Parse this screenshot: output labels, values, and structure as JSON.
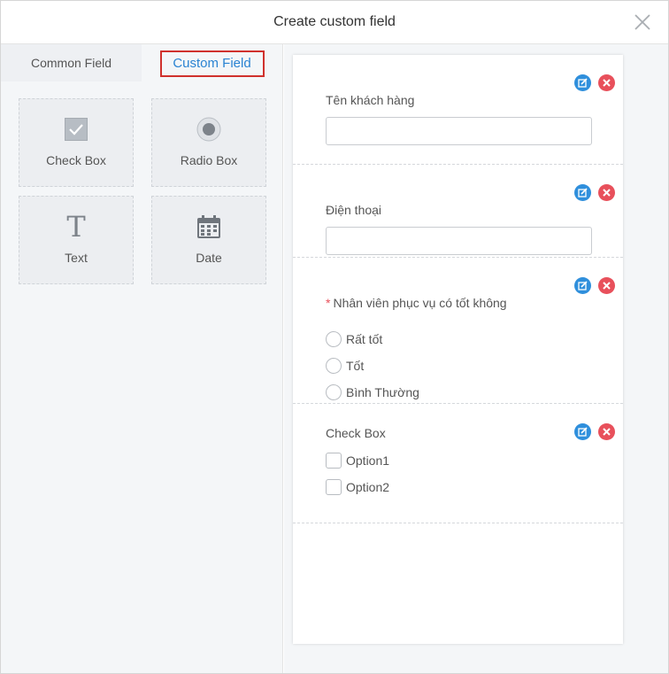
{
  "dialog": {
    "title": "Create custom field"
  },
  "tabs": {
    "common": "Common Field",
    "custom": "Custom Field"
  },
  "tiles": [
    {
      "label": "Check Box",
      "icon": "checkbox-icon"
    },
    {
      "label": "Radio Box",
      "icon": "radio-icon"
    },
    {
      "label": "Text",
      "icon": "text-icon"
    },
    {
      "label": "Date",
      "icon": "calendar-icon"
    }
  ],
  "fields": [
    {
      "type": "text",
      "label": "Tên khách hàng",
      "value": ""
    },
    {
      "type": "text",
      "label": "Điện thoại",
      "value": ""
    },
    {
      "type": "radio",
      "required_mark": "*",
      "label": "Nhân viên phục vụ có tốt không",
      "options": [
        "Rất tốt",
        "Tốt",
        "Bình Thường"
      ]
    },
    {
      "type": "checkbox",
      "label": "Check Box",
      "options": [
        "Option1",
        "Option2"
      ]
    }
  ],
  "colors": {
    "accent": "#2a83d2",
    "highlight_border": "#d0312d",
    "edit_button": "#2f8fdc",
    "delete_button": "#e8505b"
  }
}
